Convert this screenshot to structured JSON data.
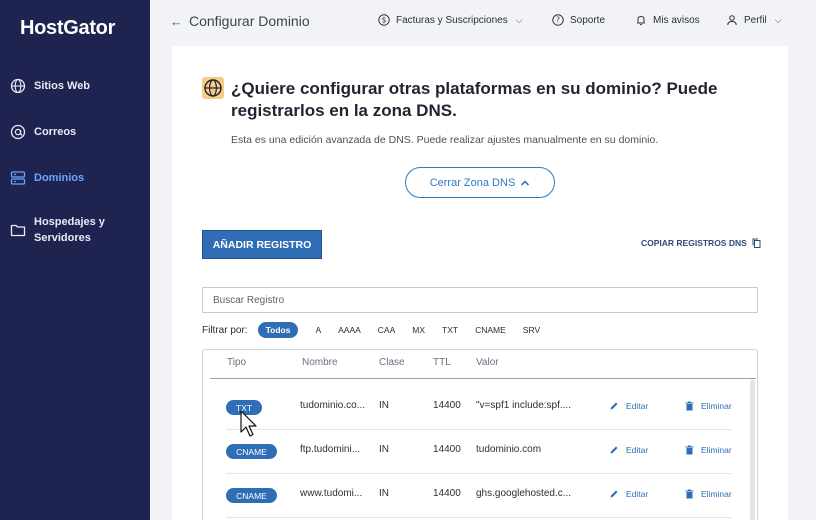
{
  "sidebar": {
    "logo": "HostGator",
    "items": [
      {
        "label": "Sitios Web",
        "icon": "globe-icon"
      },
      {
        "label": "Correos",
        "icon": "at-icon"
      },
      {
        "label": "Dominios",
        "icon": "server-icon",
        "active": true
      },
      {
        "label": "Hospedajes y Servidores",
        "icon": "folder-icon"
      }
    ]
  },
  "topbar": {
    "back_title": "Configurar Dominio",
    "billing": "Facturas y Suscripciones",
    "support": "Soporte",
    "notices": "Mis avisos",
    "profile": "Perfil"
  },
  "card": {
    "heading": "¿Quiere configurar otras plataformas en su dominio? Puede registrarlos en la zona DNS.",
    "subtext": "Esta es una edición avanzada de DNS. Puede realizar ajustes manualmente en su dominio.",
    "close_zone": "Cerrar Zona DNS",
    "add_record": "AÑADIR REGISTRO",
    "copy_records": "COPIAR REGISTROS DNS",
    "search_placeholder": "Buscar Registro",
    "filter_label": "Filtrar por:",
    "filters": [
      "Todos",
      "A",
      "AAAA",
      "CAA",
      "MX",
      "TXT",
      "CNAME",
      "SRV"
    ],
    "active_filter": "Todos"
  },
  "table": {
    "headers": [
      "Tipo",
      "Nombre",
      "Clase",
      "TTL",
      "Valor"
    ],
    "edit_label": "Editar",
    "delete_label": "Eliminar",
    "rows": [
      {
        "type": "TXT",
        "name": "tudominio.co...",
        "class": "IN",
        "ttl": "14400",
        "value": "\"v=spf1 include:spf...."
      },
      {
        "type": "CNAME",
        "name": "ftp.tudomini...",
        "class": "IN",
        "ttl": "14400",
        "value": "tudominio.com"
      },
      {
        "type": "CNAME",
        "name": "www.tudomi...",
        "class": "IN",
        "ttl": "14400",
        "value": "ghs.googlehosted.c..."
      }
    ]
  },
  "colors": {
    "sidebar_bg": "#1f2350",
    "accent": "#2f6db5",
    "active_nav": "#6aa7ff",
    "globe_badge": "#f6cd87"
  }
}
